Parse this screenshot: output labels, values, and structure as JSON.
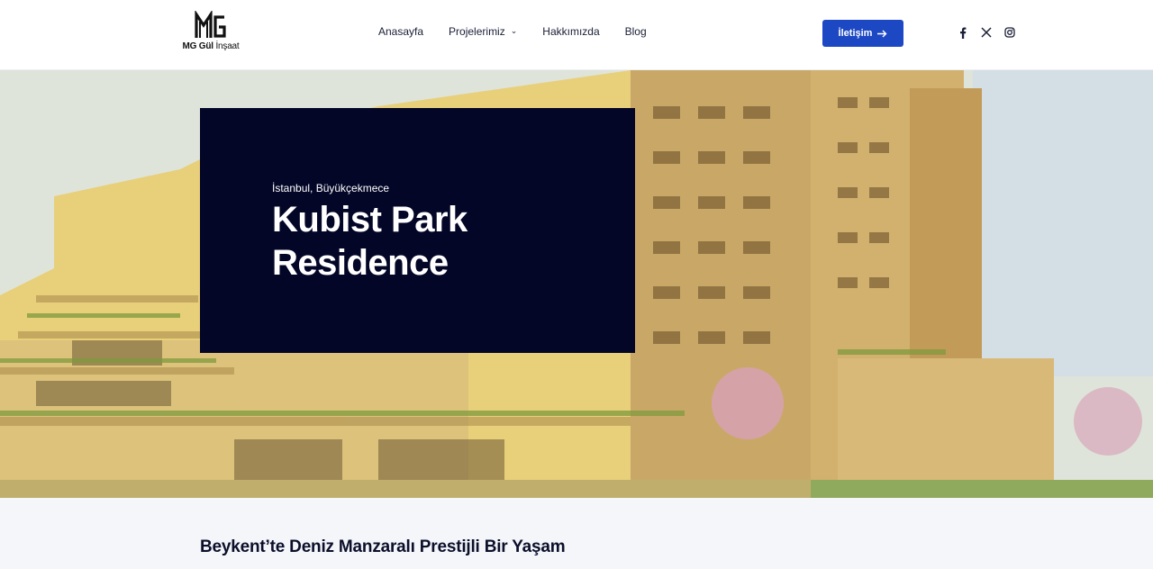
{
  "brand": {
    "logo_mark": "MG",
    "name_bold": "MG Gül",
    "name_light": "İnşaat"
  },
  "nav": {
    "items": [
      {
        "label": "Anasayfa"
      },
      {
        "label": "Projelerimiz",
        "has_dropdown": true
      },
      {
        "label": "Hakkımızda"
      },
      {
        "label": "Blog"
      }
    ],
    "cta_label": "İletişim"
  },
  "social": {
    "icons": [
      "facebook-icon",
      "x-twitter-icon",
      "instagram-icon"
    ]
  },
  "hero": {
    "location": "İstanbul, Büyükçekmece",
    "title": "Kubist Park Residence"
  },
  "section": {
    "title": "Beykent’te Deniz Manzaralı Prestijli Bir Yaşam"
  },
  "colors": {
    "accent": "#1d48c4",
    "hero_box": "#030627",
    "section_bg": "#f4f6fa"
  }
}
